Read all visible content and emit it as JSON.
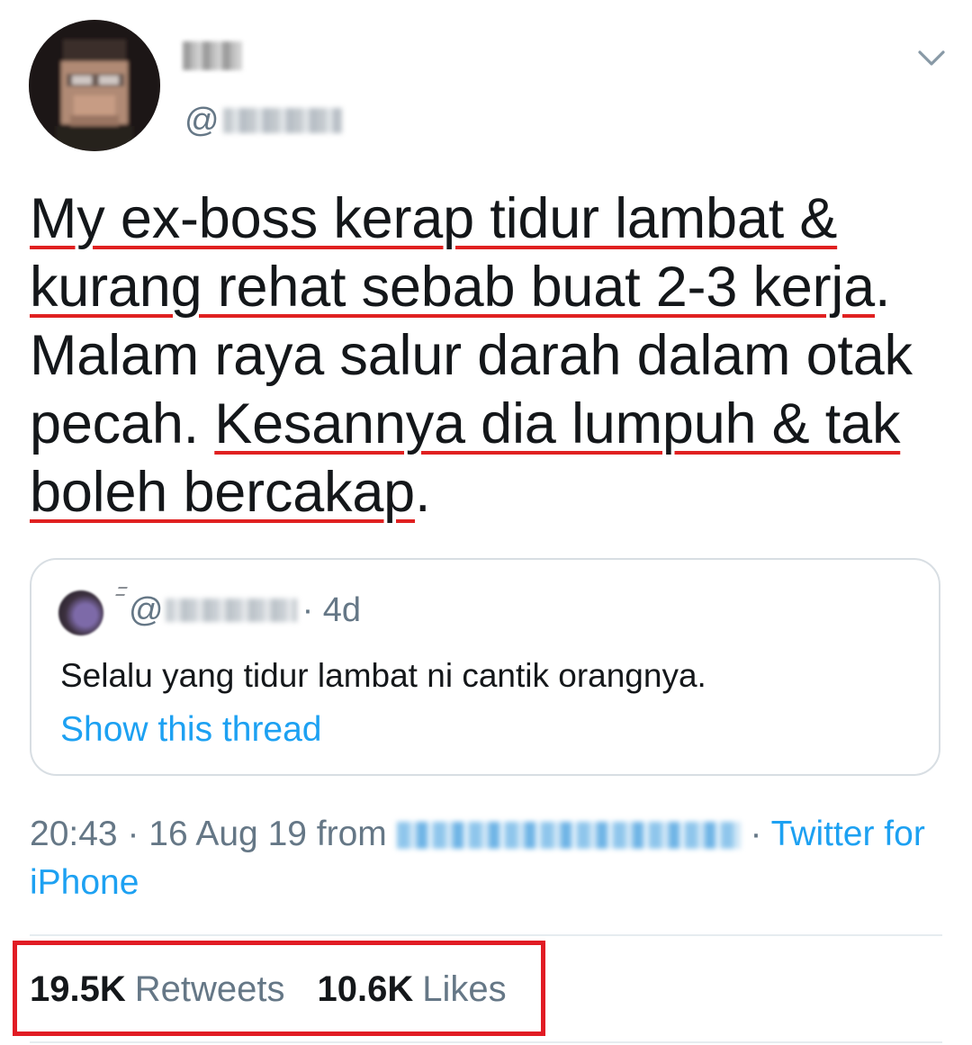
{
  "author": {
    "handle_prefix": "@",
    "caret_icon": "chevron-down-icon"
  },
  "tweet": {
    "segments": [
      {
        "text": "My ex-boss kerap tidur lambat & kurang rehat sebab buat 2-3 kerja",
        "highlight": true
      },
      {
        "text": ". Malam raya salur darah dalam otak pecah. ",
        "highlight": false
      },
      {
        "text": "Kesannya dia lumpuh & tak boleh bercakap",
        "highlight": true
      },
      {
        "text": ".",
        "highlight": false
      }
    ],
    "highlight_color": "#e02020"
  },
  "quote": {
    "handle_prefix": "@",
    "time": "· 4d",
    "text": "Selalu yang tidur lambat ni cantik orangnya.",
    "show_thread": "Show this thread"
  },
  "meta": {
    "time": "20:43",
    "date": "16 Aug 19",
    "from": "from",
    "source": "Twitter for iPhone"
  },
  "stats": {
    "retweets_count": "19.5K",
    "retweets_label": "Retweets",
    "likes_count": "10.6K",
    "likes_label": "Likes"
  },
  "colors": {
    "text": "#14171a",
    "secondary": "#657786",
    "link": "#1da1f2",
    "annotation": "#e11c24"
  }
}
